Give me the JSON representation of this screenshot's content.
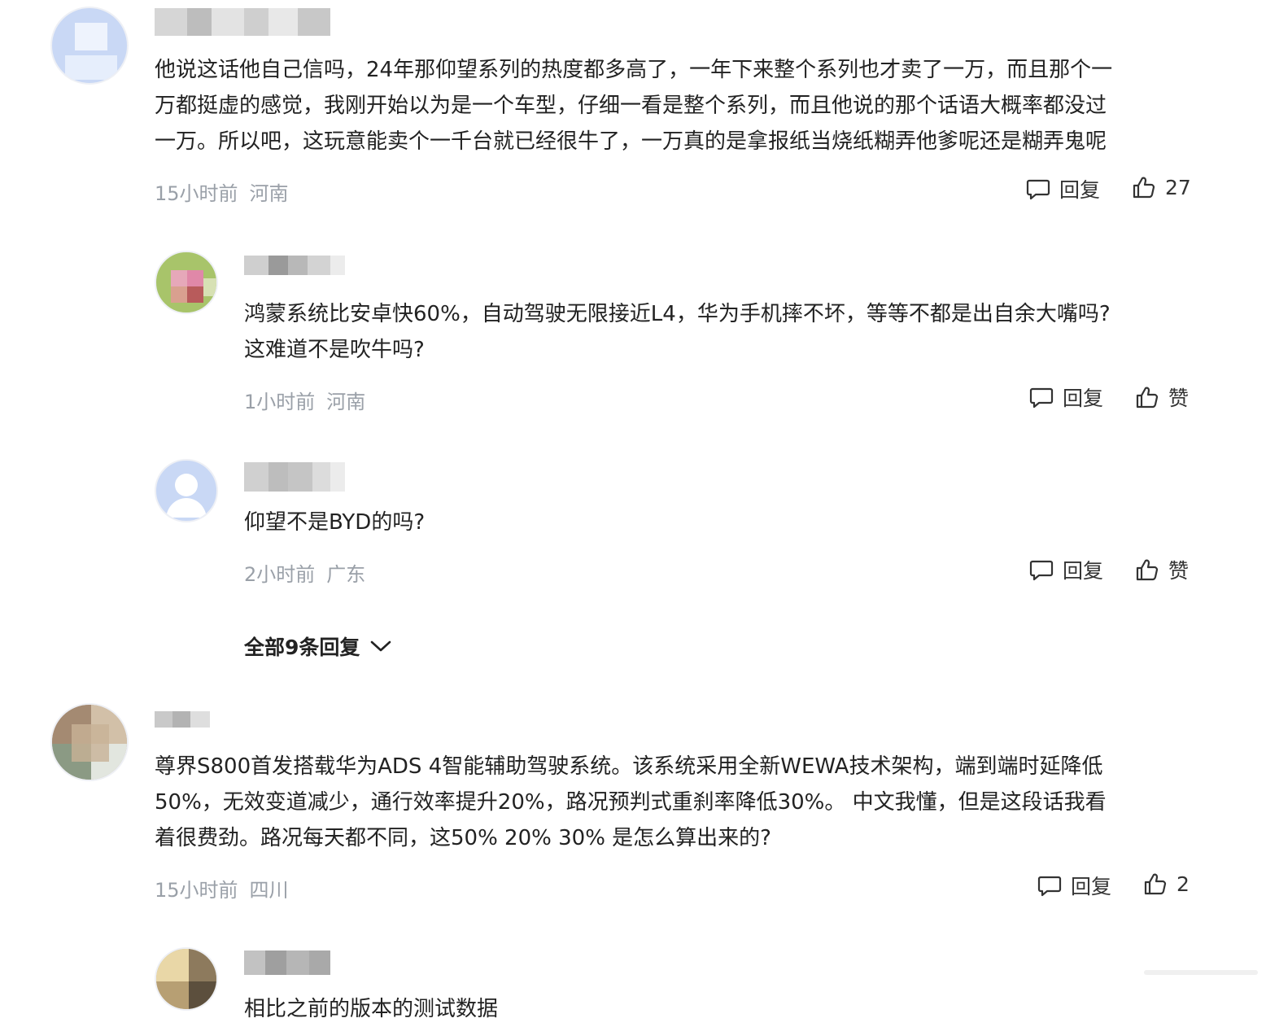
{
  "comments": [
    {
      "lines": [
        "他说这话他自己信吗，24年那仰望系列的热度都多高了，一年下来整个系列也才卖了一万，而且那个一",
        "万都挺虚的感觉，我刚开始以为是一个车型，仔细一看是整个系列，而且他说的那个话语大概率都没过",
        "一万。所以吧，这玩意能卖个一千台就已经很牛了，一万真的是拿报纸当烧纸糊弄他爹呢还是糊弄鬼呢"
      ],
      "time": "15小时前",
      "location": "河南",
      "reply_label": "回复",
      "like_label": "27",
      "replies": [
        {
          "lines": [
            "鸿蒙系统比安卓快60%，自动驾驶无限接近L4，华为手机摔不坏，等等不都是出自余大嘴吗?",
            "这难道不是吹牛吗?"
          ],
          "time": "1小时前",
          "location": "河南",
          "reply_label": "回复",
          "like_label": "赞"
        },
        {
          "lines": [
            "仰望不是BYD的吗?"
          ],
          "time": "2小时前",
          "location": "广东",
          "reply_label": "回复",
          "like_label": "赞"
        }
      ],
      "expand_label": "全部9条回复"
    },
    {
      "lines": [
        "尊界S800首发搭载华为ADS 4智能辅助驾驶系统。该系统采用全新WEWA技术架构，端到端时延降低",
        "50%，无效变道减少，通行效率提升20%，路况预判式重刹率降低30%。 中文我懂，但是这段话我看",
        "着很费劲。路况每天都不同，这50% 20% 30% 是怎么算出来的?"
      ],
      "time": "15小时前",
      "location": "四川",
      "reply_label": "回复",
      "like_label": "2",
      "replies": [
        {
          "lines": [
            "相比之前的版本的测试数据"
          ]
        }
      ]
    }
  ],
  "colors": {
    "text": "#222222",
    "meta": "#9aa0a8",
    "background": "#ffffff"
  },
  "icons": [
    "comment-bubble-icon",
    "thumbs-up-icon",
    "chevron-down-icon",
    "default-avatar-icon"
  ]
}
